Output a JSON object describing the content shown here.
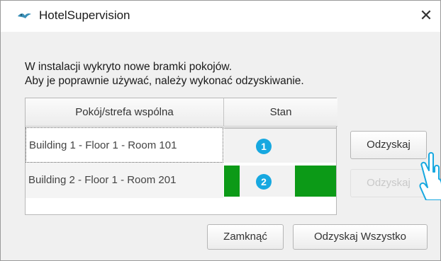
{
  "window": {
    "title": "HotelSupervision",
    "close_glyph": "✕",
    "app_icon": "bird-logo-icon"
  },
  "message": {
    "line1": "W instalacji wykryto nowe bramki pokojów.",
    "line2": "Aby je poprawnie używać, należy wykonać odzyskiwanie."
  },
  "table": {
    "columns": [
      "Pokój/strefa wspólna",
      "Stan"
    ],
    "rows": [
      {
        "room": "Building 1 - Floor 1 - Room 101",
        "badge": "1",
        "button": "Odzyskaj",
        "button_enabled": true
      },
      {
        "room": "Building 2 - Floor 1 - Room 201",
        "badge": "2",
        "button": "Odzyskaj",
        "button_enabled": false
      }
    ]
  },
  "footer": {
    "close_label": "Zamknąć",
    "recover_all_label": "Odzyskaj Wszystko"
  },
  "colors": {
    "progress_green": "#0c9a17",
    "badge_blue": "#17a8e0"
  }
}
